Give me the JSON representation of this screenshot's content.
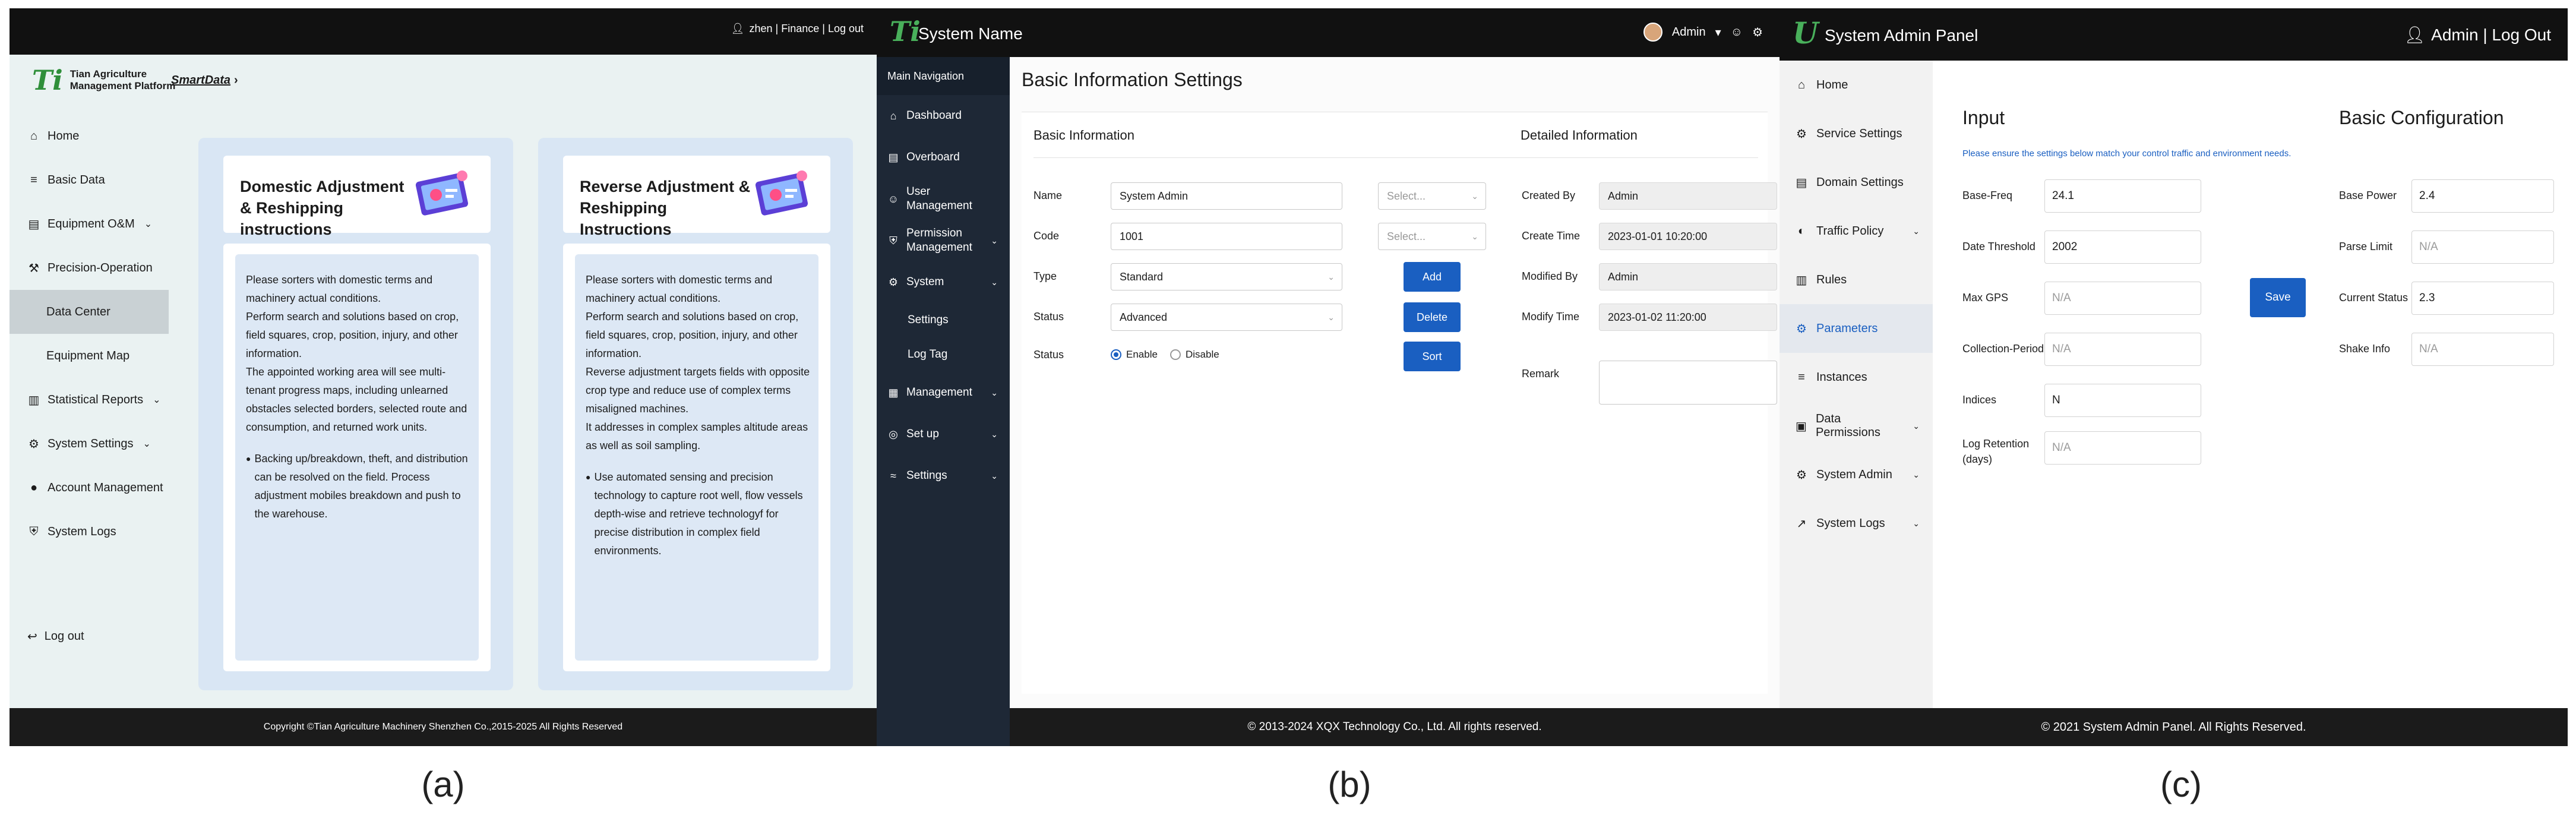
{
  "captions": [
    "(a)",
    "(b)",
    "(c)"
  ],
  "panel_a": {
    "user_bar": "zhen | Finance | Log out",
    "brand_line1": "Tian Agriculture",
    "brand_line2": "Management Platform",
    "breadcrumb": "SmartData",
    "nav": [
      {
        "label": "Home",
        "icon": "home-icon"
      },
      {
        "label": "Basic Data",
        "icon": "database-icon"
      },
      {
        "label": "Equipment O&M",
        "icon": "document-icon"
      },
      {
        "label": "Precision-Operation",
        "icon": "wrench-icon"
      },
      {
        "label": "Data Center"
      },
      {
        "label": "Equipment Map"
      },
      {
        "label": "Statistical Reports",
        "icon": "report-icon"
      },
      {
        "label": "System Settings",
        "icon": "gear-icon"
      },
      {
        "label": "Account Management",
        "icon": "account-icon"
      },
      {
        "label": "System Logs",
        "icon": "shield-icon"
      }
    ],
    "logout": "Log out",
    "cards": [
      {
        "title": "Domestic Adjustment & Reshipping instructions",
        "body": "Please sorters with domestic terms and machinery actual conditions.\nPerform search and solutions based on crop, field squares, crop, position, injury, and other information.\nThe appointed working area will see multi-tenant progress maps, including unlearned obstacles selected borders, selected route and consumption, and returned work units.",
        "bullet": "Backing up/breakdown, theft, and distribution can be resolved on the field. Process adjustment mobiles breakdown and push to the warehouse."
      },
      {
        "title": "Reverse Adjustment & Reshipping Instructions",
        "body": "Please sorters with domestic terms and machinery actual conditions.\nPerform search and solutions based on crop, field squares, crop, position, injury, and other information.\nReverse adjustment targets fields with opposite crop type and reduce use of complex terms misaligned machines.\nIt addresses in complex samples altitude areas as well as soil sampling.",
        "bullet": "Use automated sensing and precision technology to capture root well, flow vessels depth-wise and retrieve technologyf for precise distribution in complex field environments."
      }
    ],
    "footer": "Copyright ©Tian Agriculture Machinery Shenzhen Co.,2015-2025 All Rights Reserved"
  },
  "panel_b": {
    "system_name": "System Name",
    "user": "Admin",
    "sidebar_header": "Main Navigation",
    "nav": [
      {
        "label": "Dashboard",
        "icon": "dashboard-icon"
      },
      {
        "label": "Overboard",
        "icon": "document-icon"
      },
      {
        "label": "User Management",
        "icon": "user-icon"
      },
      {
        "label": "Permission Management",
        "icon": "shield-icon"
      },
      {
        "label": "System",
        "icon": "gear-icon"
      },
      {
        "label": "Settings"
      },
      {
        "label": "Log Tag"
      },
      {
        "label": "Management",
        "icon": "building-icon"
      },
      {
        "label": "Set up",
        "icon": "location-icon"
      },
      {
        "label": "Settings",
        "icon": "wifi-icon"
      }
    ],
    "page_title": "Basic Information Settings",
    "section_basic": "Basic Information",
    "section_detail": "Detailed Information",
    "form": {
      "name_label": "Name",
      "name_value": "System Admin",
      "code_label": "Code",
      "code_value": "1001",
      "type_label": "Type",
      "type_value": "Standard",
      "status_label": "Status",
      "status_value": "Advanced",
      "status2_label": "Status",
      "radio_enable": "Enable",
      "radio_disable": "Disable",
      "select_placeholder": "Select..."
    },
    "buttons": {
      "add": "Add",
      "delete": "Delete",
      "sort": "Sort"
    },
    "detail": {
      "created_by_label": "Created By",
      "created_by": "Admin",
      "create_time_label": "Create Time",
      "create_time": "2023-01-01 10:20:00",
      "modified_by_label": "Modified By",
      "modified_by": "Admin",
      "modify_time_label": "Modify Time",
      "modify_time": "2023-01-02 11:20:00",
      "remark_label": "Remark"
    },
    "footer": "© 2013-2024 XQX Technology Co., Ltd. All rights reserved."
  },
  "panel_c": {
    "title": "System Admin Panel",
    "user": "Admin | Log Out",
    "nav": [
      {
        "label": "Home",
        "icon": "home-icon"
      },
      {
        "label": "Service Settings",
        "icon": "gear-icon"
      },
      {
        "label": "Domain Settings",
        "icon": "document-icon"
      },
      {
        "label": "Traffic Policy",
        "icon": "contrast-icon"
      },
      {
        "label": "Rules",
        "icon": "rules-icon"
      },
      {
        "label": "Parameters",
        "icon": "gear-icon"
      },
      {
        "label": "Instances",
        "icon": "database-icon"
      },
      {
        "label": "Data Permissions",
        "icon": "lock-icon"
      },
      {
        "label": "System Admin",
        "icon": "gear-icon"
      },
      {
        "label": "System Logs",
        "icon": "chart-icon"
      }
    ],
    "input_heading": "Input",
    "config_heading": "Basic Configuration",
    "note": "Please ensure the settings below match your control traffic and environment needs.",
    "fields_left": [
      {
        "label": "Base-Freq",
        "value": "24.1"
      },
      {
        "label": "Date Threshold",
        "value": "2002"
      },
      {
        "label": "Max GPS",
        "placeholder": "N/A"
      },
      {
        "label": "Collection-Period",
        "placeholder": "N/A"
      },
      {
        "label": "Indices",
        "value": "N"
      },
      {
        "label": "Log Retention (days)",
        "placeholder": "N/A"
      }
    ],
    "fields_right": [
      {
        "label": "Base Power",
        "value": "2.4"
      },
      {
        "label": "Parse Limit",
        "placeholder": "N/A"
      },
      {
        "label": "Current Status",
        "value": "2.3"
      },
      {
        "label": "Shake Info",
        "placeholder": "N/A"
      }
    ],
    "save": "Save",
    "footer": "© 2021 System Admin Panel. All Rights Reserved."
  }
}
